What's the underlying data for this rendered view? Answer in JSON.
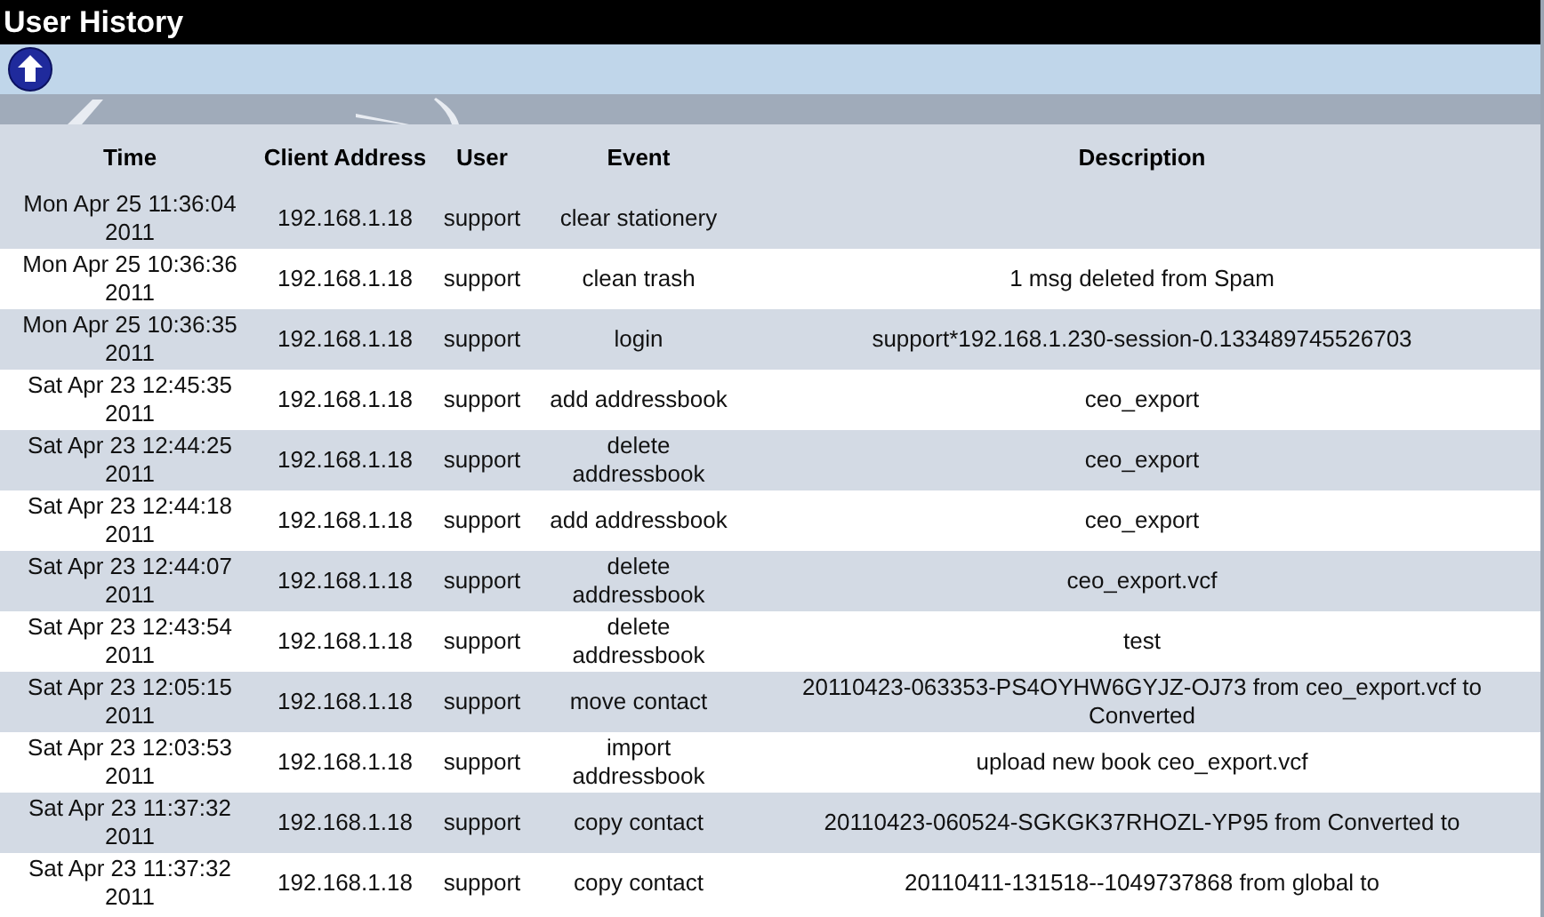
{
  "window": {
    "title": "User History"
  },
  "table": {
    "columns": [
      "Time",
      "Client Address",
      "User",
      "Event",
      "Description"
    ],
    "rows": [
      {
        "time": "Mon Apr 25 11:36:04 2011",
        "client_address": "192.168.1.18",
        "user": "support",
        "event": "clear stationery",
        "description": ""
      },
      {
        "time": "Mon Apr 25 10:36:36 2011",
        "client_address": "192.168.1.18",
        "user": "support",
        "event": "clean trash",
        "description": "1 msg deleted from Spam"
      },
      {
        "time": "Mon Apr 25 10:36:35 2011",
        "client_address": "192.168.1.18",
        "user": "support",
        "event": "login",
        "description": "support*192.168.1.230-session-0.133489745526703"
      },
      {
        "time": "Sat Apr 23 12:45:35 2011",
        "client_address": "192.168.1.18",
        "user": "support",
        "event": "add addressbook",
        "description": "ceo_export"
      },
      {
        "time": "Sat Apr 23 12:44:25 2011",
        "client_address": "192.168.1.18",
        "user": "support",
        "event": "delete addressbook",
        "description": "ceo_export"
      },
      {
        "time": "Sat Apr 23 12:44:18 2011",
        "client_address": "192.168.1.18",
        "user": "support",
        "event": "add addressbook",
        "description": "ceo_export"
      },
      {
        "time": "Sat Apr 23 12:44:07 2011",
        "client_address": "192.168.1.18",
        "user": "support",
        "event": "delete addressbook",
        "description": "ceo_export.vcf"
      },
      {
        "time": "Sat Apr 23 12:43:54 2011",
        "client_address": "192.168.1.18",
        "user": "support",
        "event": "delete addressbook",
        "description": "test"
      },
      {
        "time": "Sat Apr 23 12:05:15 2011",
        "client_address": "192.168.1.18",
        "user": "support",
        "event": "move contact",
        "description": "20110423-063353-PS4OYHW6GYJZ-OJ73 from ceo_export.vcf to Converted"
      },
      {
        "time": "Sat Apr 23 12:03:53 2011",
        "client_address": "192.168.1.18",
        "user": "support",
        "event": "import addressbook",
        "description": "upload new book ceo_export.vcf"
      },
      {
        "time": "Sat Apr 23 11:37:32 2011",
        "client_address": "192.168.1.18",
        "user": "support",
        "event": "copy contact",
        "description": "20110423-060524-SGKGK37RHOZL-YP95 from Converted to"
      },
      {
        "time": "Sat Apr 23 11:37:32 2011",
        "client_address": "192.168.1.18",
        "user": "support",
        "event": "copy contact",
        "description": "20110411-131518--1049737868 from global to"
      }
    ]
  }
}
